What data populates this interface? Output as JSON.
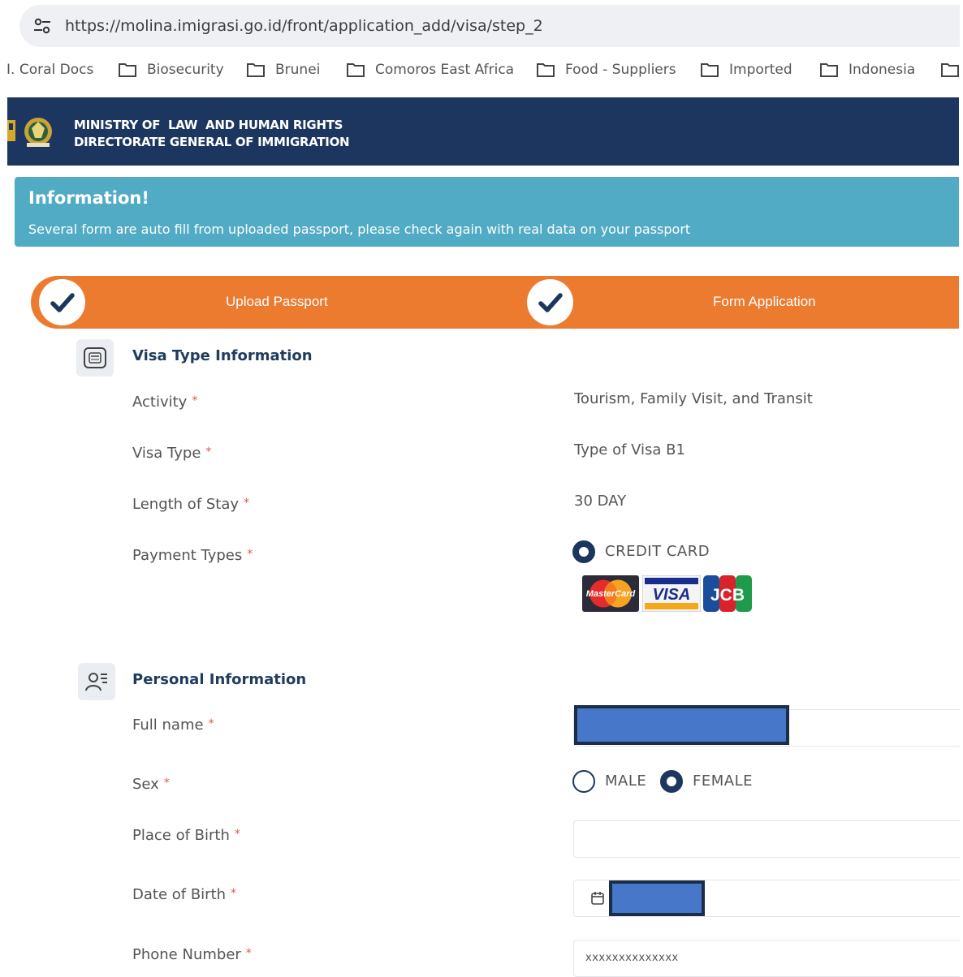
{
  "browser": {
    "url": "https://molina.imigrasi.go.id/front/application_add/visa/step_2",
    "bookmarks": [
      "I. Coral Docs",
      "Biosecurity",
      "Brunei",
      "Comoros East Africa",
      "Food - Suppliers",
      "Imported",
      "Indonesia"
    ]
  },
  "header": {
    "line1": "MINISTRY OF  LAW  AND HUMAN RIGHTS",
    "line2": "DIRECTORATE GENERAL OF IMMIGRATION"
  },
  "info": {
    "title": "Information!",
    "message": "Several form are auto fill from uploaded passport, please check again with real data on your passport"
  },
  "steps": [
    {
      "label": "Upload Passport",
      "done": true
    },
    {
      "label": "Form Application",
      "done": true
    }
  ],
  "visa_section": {
    "title": "Visa Type Information",
    "fields": {
      "activity": {
        "label": "Activity",
        "value": "Tourism, Family Visit, and Transit"
      },
      "visa_type": {
        "label": "Visa Type",
        "value": "Type of Visa B1"
      },
      "length_of_stay": {
        "label": "Length of Stay",
        "value": "30 DAY"
      },
      "payment_types": {
        "label": "Payment Types",
        "option": "CREDIT CARD",
        "cards": [
          "MasterCard",
          "VISA",
          "JCB"
        ]
      }
    }
  },
  "personal_section": {
    "title": "Personal Information",
    "fields": {
      "full_name": {
        "label": "Full name"
      },
      "sex": {
        "label": "Sex",
        "options": [
          "MALE",
          "FEMALE"
        ],
        "selected": "FEMALE"
      },
      "place_of_birth": {
        "label": "Place of Birth",
        "value": ""
      },
      "date_of_birth": {
        "label": "Date of Birth"
      },
      "phone_number": {
        "label": "Phone Number",
        "value": "xxxxxxxxxxxxxx"
      }
    }
  },
  "required_marker": "*",
  "colors": {
    "header_bg": "#1c365f",
    "info_bg": "#52abc4",
    "steps_bg": "#ec7a2f",
    "redaction": "#4677c9"
  }
}
